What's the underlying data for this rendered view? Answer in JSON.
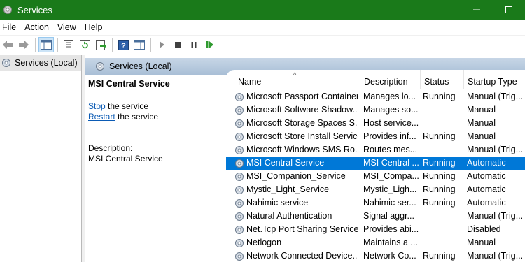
{
  "window": {
    "title": "Services",
    "icon": "gear-icon"
  },
  "menu": [
    "File",
    "Action",
    "View",
    "Help"
  ],
  "toolbar": {
    "icons": [
      "back-icon",
      "forward-icon",
      "show-hide-tree-icon",
      "properties-icon",
      "refresh-icon",
      "export-icon",
      "help-icon",
      "console-icon",
      "start-icon",
      "stop-icon",
      "pause-icon",
      "resume-icon"
    ]
  },
  "tree": {
    "item_label": "Services (Local)"
  },
  "panel": {
    "header_title": "Services (Local)"
  },
  "detail": {
    "service_name": "MSI Central Service",
    "stop_link": "Stop",
    "stop_rest": " the service",
    "restart_link": "Restart",
    "restart_rest": " the service",
    "description_label": "Description:",
    "description_text": "MSI Central Service"
  },
  "columns": [
    "Name",
    "Description",
    "Status",
    "Startup Type"
  ],
  "services": [
    {
      "name": "Microsoft Passport Container",
      "description": "Manages lo...",
      "status": "Running",
      "startup": "Manual (Trig..."
    },
    {
      "name": "Microsoft Software Shadow...",
      "description": "Manages so...",
      "status": "",
      "startup": "Manual"
    },
    {
      "name": "Microsoft Storage Spaces S...",
      "description": "Host service...",
      "status": "",
      "startup": "Manual"
    },
    {
      "name": "Microsoft Store Install Service",
      "description": "Provides inf...",
      "status": "Running",
      "startup": "Manual"
    },
    {
      "name": "Microsoft Windows SMS Ro...",
      "description": "Routes mes...",
      "status": "",
      "startup": "Manual (Trig..."
    },
    {
      "name": "MSI Central Service",
      "description": "MSI Central ...",
      "status": "Running",
      "startup": "Automatic",
      "selected": true
    },
    {
      "name": "MSI_Companion_Service",
      "description": "MSI_Compa...",
      "status": "Running",
      "startup": "Automatic"
    },
    {
      "name": "Mystic_Light_Service",
      "description": "Mystic_Ligh...",
      "status": "Running",
      "startup": "Automatic"
    },
    {
      "name": "Nahimic service",
      "description": "Nahimic ser...",
      "status": "Running",
      "startup": "Automatic"
    },
    {
      "name": "Natural Authentication",
      "description": "Signal aggr...",
      "status": "",
      "startup": "Manual (Trig..."
    },
    {
      "name": "Net.Tcp Port Sharing Service",
      "description": "Provides abi...",
      "status": "",
      "startup": "Disabled"
    },
    {
      "name": "Netlogon",
      "description": "Maintains a ...",
      "status": "",
      "startup": "Manual"
    },
    {
      "name": "Network Connected Device...",
      "description": "Network Co...",
      "status": "Running",
      "startup": "Manual (Trig..."
    }
  ]
}
